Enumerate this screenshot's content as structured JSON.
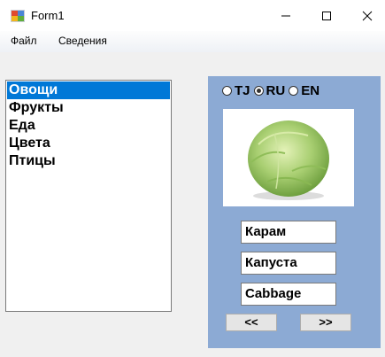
{
  "window": {
    "title": "Form1",
    "controls": {
      "minimize": "—",
      "maximize": "☐",
      "close": "✕"
    }
  },
  "menu": {
    "file": "Файл",
    "info": "Сведения"
  },
  "list": {
    "items": [
      "Овощи",
      "Фрукты",
      "Еда",
      "Цвета",
      "Птицы"
    ],
    "selected_index": 0
  },
  "languages": [
    {
      "label": "TJ",
      "checked": false
    },
    {
      "label": "RU",
      "checked": true
    },
    {
      "label": "EN",
      "checked": false
    }
  ],
  "fields": {
    "tj": "Карам",
    "ru": "Капуста",
    "en": "Cabbage"
  },
  "buttons": {
    "prev": "<<",
    "next": ">>"
  },
  "image": {
    "subject": "cabbage"
  },
  "colors": {
    "panel": "#8caad4",
    "selection": "#0078d7"
  }
}
